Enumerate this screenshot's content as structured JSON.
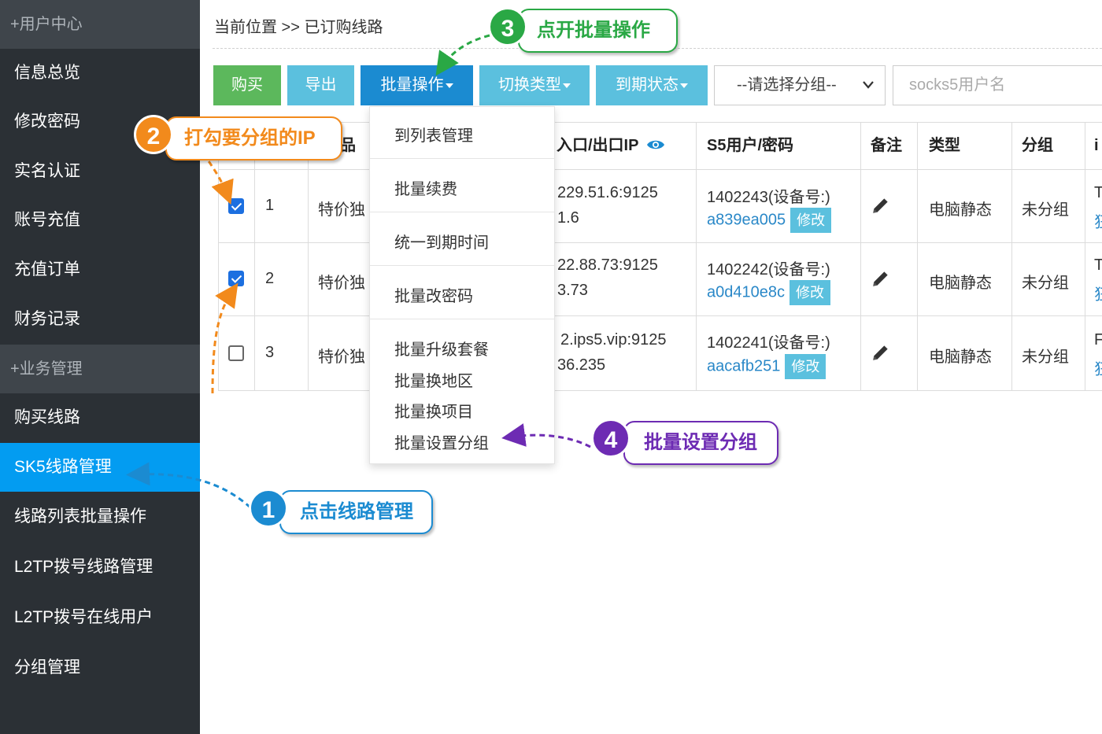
{
  "sidebar": {
    "section1": "+用户中心",
    "items1": [
      "信息总览",
      "修改密码",
      "实名认证",
      "账号充值",
      "充值订单",
      "财务记录"
    ],
    "section2": "+业务管理",
    "items2": [
      "购买线路",
      "SK5线路管理",
      "线路列表批量操作",
      "L2TP拨号线路管理",
      "L2TP拨号在线用户",
      "分组管理"
    ],
    "active": "SK5线路管理"
  },
  "breadcrumb": "当前位置 >> 已订购线路",
  "toolbar": {
    "buy": "购买",
    "export": "导出",
    "batch": "批量操作",
    "switch_type": "切换类型",
    "expire_status": "到期状态",
    "group_select": "--请选择分组--",
    "username_placeholder": "socks5用户名",
    "colors": {
      "buy": "#5cb85c",
      "info": "#5bc0de",
      "primary": "#1b8bd1"
    }
  },
  "table": {
    "headers": [
      "品",
      "入口/出口IP",
      "S5用户/密码",
      "备注",
      "类型",
      "分组",
      "i"
    ],
    "rows": [
      {
        "checked": true,
        "num": "1",
        "product": "特价独",
        "ip1": "229.51.6:9125",
        "ip2": "1.6",
        "user": "1402243(设备号:)",
        "pass": "a839ea005",
        "edit": "修改",
        "type": "电脑静态",
        "group": "未分组",
        "extra1": "T",
        "extra2": "狂"
      },
      {
        "checked": true,
        "num": "2",
        "product": "特价独",
        "ip1": "22.88.73:9125",
        "ip2": "3.73",
        "user": "1402242(设备号:)",
        "pass": "a0d410e8c",
        "edit": "修改",
        "type": "电脑静态",
        "group": "未分组",
        "extra1": "T",
        "extra2": "狂"
      },
      {
        "checked": false,
        "num": "3",
        "product": "特价独",
        "ip1": "2.ips5.vip:9125",
        "ip2": "36.235",
        "user": "1402241(设备号:)",
        "pass": "aacafb251",
        "edit": "修改",
        "type": "电脑静态",
        "group": "未分组",
        "extra1": "F",
        "extra2": "狂"
      }
    ]
  },
  "dropdown": [
    "到列表管理",
    "批量续费",
    "统一到期时间",
    "批量改密码",
    "批量升级套餐",
    "批量换地区",
    "批量换项目",
    "批量设置分组"
  ],
  "callouts": [
    {
      "num": "1",
      "text": "点击线路管理",
      "color": "#1b8bd1"
    },
    {
      "num": "2",
      "text": "打勾要分组的IP",
      "color": "#f28a1c"
    },
    {
      "num": "3",
      "text": "点开批量操作",
      "color": "#2aa845"
    },
    {
      "num": "4",
      "text": "批量设置分组",
      "color": "#6d2bb3"
    }
  ]
}
